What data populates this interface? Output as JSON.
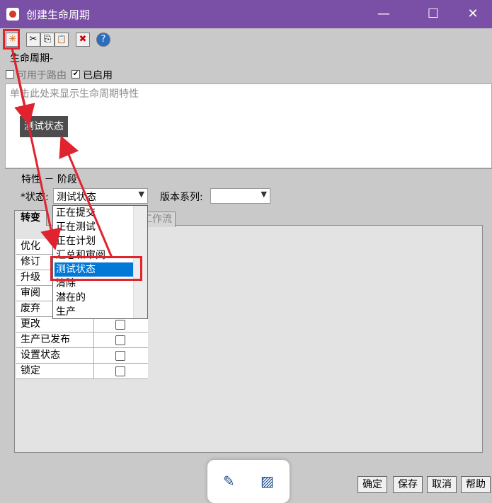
{
  "window": {
    "title": "创建生命周期",
    "minimize_glyph": "—",
    "maximize_glyph": "☐",
    "close_glyph": "✕"
  },
  "toolbar": {
    "buttons": [
      {
        "icon": "new-state-icon",
        "glyph": "✳"
      },
      {
        "icon": "cut-icon",
        "glyph": "✂"
      },
      {
        "icon": "copy-icon",
        "glyph": "⎘"
      },
      {
        "icon": "paste-icon",
        "glyph": "📋"
      },
      {
        "icon": "delete-icon",
        "glyph": "✖"
      },
      {
        "icon": "help-icon",
        "glyph": "?"
      }
    ]
  },
  "lifecycle_label": "生命周期-",
  "options": {
    "routable_label": "可用于路由",
    "routable_checked": false,
    "enabled_label": "已启用",
    "enabled_checked": true
  },
  "props_area": {
    "hint": "单击此处来显示生命周期特性",
    "state_node": "测试状态"
  },
  "section_title": "特性 － 阶段",
  "state_field": {
    "label": "*状态:",
    "value": "测试状态",
    "options": [
      "正在提交",
      "正在测试",
      "正在计划",
      "汇总和审阅",
      "测试状态",
      "清除",
      "潜在的",
      "生产"
    ],
    "selected_index": 4
  },
  "version_series": {
    "label": "版本系列:",
    "value": ""
  },
  "tabs": [
    "转变",
    "工作流"
  ],
  "transitions": [
    {
      "name": "优化",
      "checked": false
    },
    {
      "name": "修订",
      "checked": false
    },
    {
      "name": "升级",
      "checked": false
    },
    {
      "name": "审阅",
      "checked": false
    },
    {
      "name": "废弃",
      "checked": false
    },
    {
      "name": "更改",
      "checked": false
    },
    {
      "name": "生产已发布",
      "checked": false
    },
    {
      "name": "设置状态",
      "checked": false
    },
    {
      "name": "锁定",
      "checked": false
    }
  ],
  "floating_toolbar": {
    "left_icon": "magic-wand-icon",
    "right_icon": "hatch-pattern-icon"
  },
  "buttons": {
    "ok": "确定",
    "save": "保存",
    "cancel": "取消",
    "help": "帮助"
  },
  "colors": {
    "titlebar": "#7a4fa6",
    "highlight": "#e0232f",
    "selection": "#0078d7"
  }
}
